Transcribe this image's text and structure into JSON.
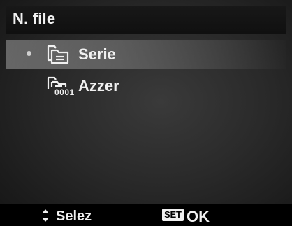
{
  "header": {
    "title": "N. file"
  },
  "menu": {
    "items": [
      {
        "label": "Serie",
        "icon": "folder-series-icon",
        "selected": true
      },
      {
        "label": "Azzer",
        "icon": "folder-reset-icon",
        "sublabel": "0001",
        "selected": false
      }
    ]
  },
  "footer": {
    "select_label": "Selez",
    "set_label": "SET",
    "ok_label": "OK"
  },
  "colors": {
    "header_bg": "#181818",
    "text": "#f0f0f0",
    "background": "#2a2a2a",
    "highlight": "#a0a0a0"
  }
}
